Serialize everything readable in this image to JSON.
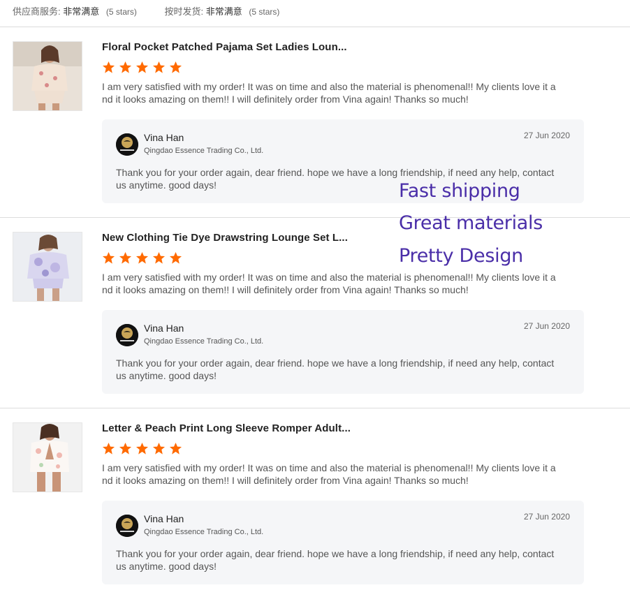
{
  "summary": {
    "supplier_label": "供应商服务:",
    "supplier_value": "非常满意",
    "supplier_stars": "(5 stars)",
    "shipping_label": "按时发货:",
    "shipping_value": "非常满意",
    "shipping_stars": "(5 stars)"
  },
  "colors": {
    "star": "#ff6a00",
    "overlay_text": "#4a2ea8",
    "reply_bg": "#f5f6f8"
  },
  "reviews": [
    {
      "title": "Floral Pocket Patched Pajama Set Ladies Loun...",
      "rating": 5,
      "text": "I am very satisfied with my order! It was on time and also the material is phenomenal!! My clients love it and it looks amazing on them!! I will definitely order from Vina again! Thanks so much!",
      "reply": {
        "seller": "Vina Han",
        "company": "Qingdao Essence Trading Co., Ltd.",
        "date": "27 Jun 2020",
        "text": "Thank you for your order again, dear friend. hope we have a long friendship, if need any help, contact us anytime. good days!"
      }
    },
    {
      "title": "New Clothing Tie Dye Drawstring Lounge Set L...",
      "rating": 5,
      "text": "I am very satisfied with my order! It was on time and also the material is phenomenal!! My clients love it and it looks amazing on them!! I will definitely order from Vina again! Thanks so much!",
      "reply": {
        "seller": "Vina Han",
        "company": "Qingdao Essence Trading Co., Ltd.",
        "date": "27 Jun 2020",
        "text": "Thank you for your order again, dear friend. hope we have a long friendship, if need any help, contact us anytime. good days!"
      }
    },
    {
      "title": "Letter & Peach Print Long Sleeve Romper Adult...",
      "rating": 5,
      "text": "I am very satisfied with my order! It was on time and also the material is phenomenal!! My clients love it and it looks amazing on them!! I will definitely order from Vina again! Thanks so much!",
      "reply": {
        "seller": "Vina Han",
        "company": "Qingdao Essence Trading Co., Ltd.",
        "date": "27 Jun 2020",
        "text": "Thank you for your order again, dear friend. hope we have a long friendship, if need any help, contact us anytime. good days!"
      }
    }
  ],
  "overlay": [
    "Fast shipping",
    "Great materials",
    "Pretty Design"
  ]
}
